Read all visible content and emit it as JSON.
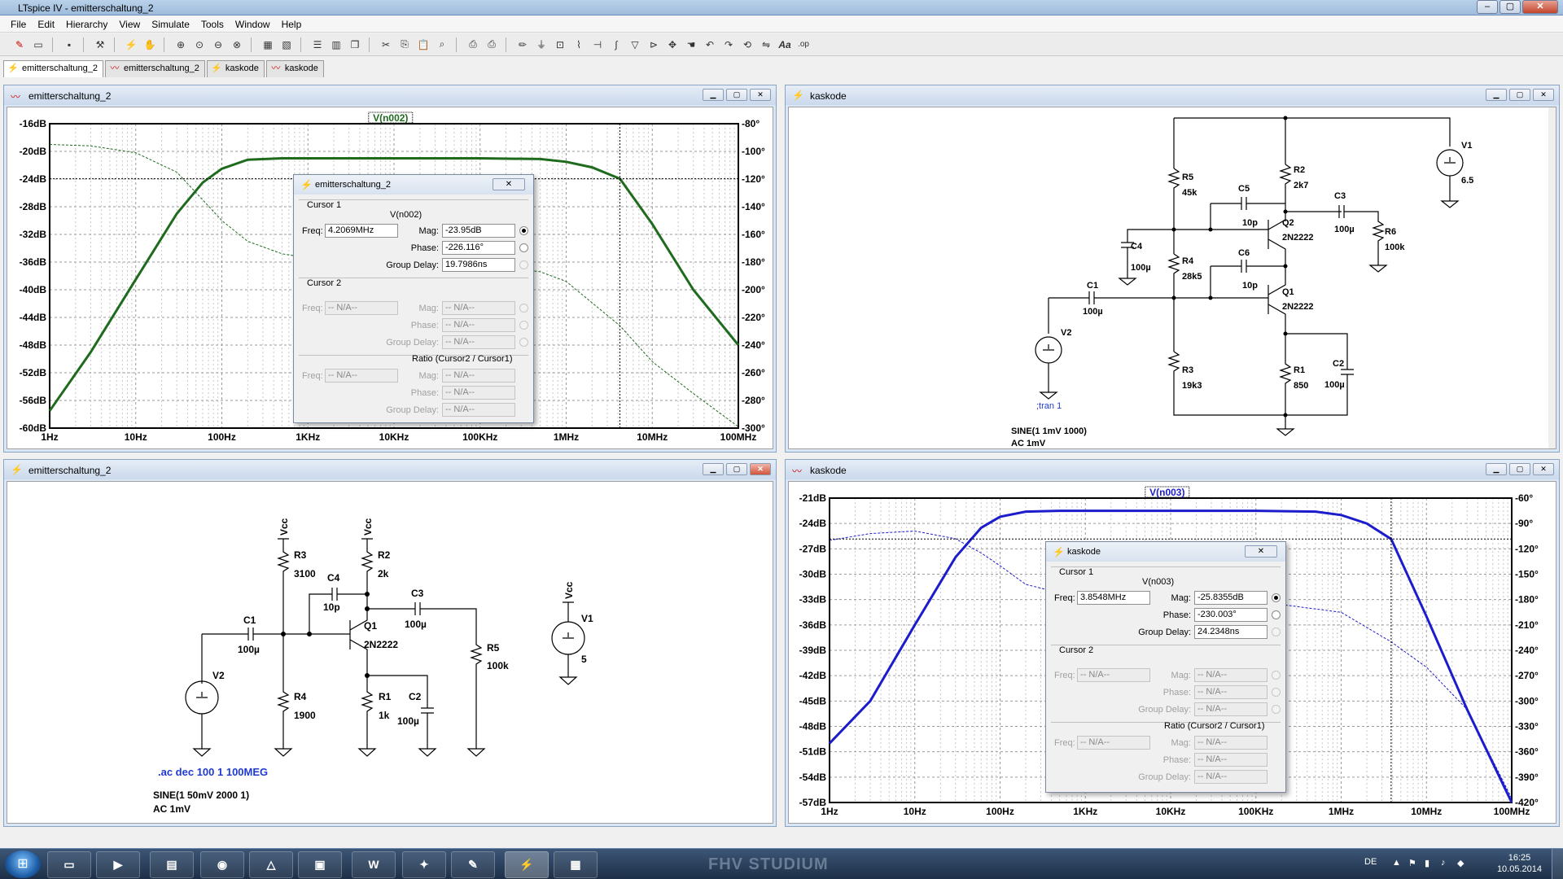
{
  "app": {
    "title": "LTspice IV - emitterschaltung_2",
    "min": "0",
    "max": "1",
    "close": "r"
  },
  "menu": [
    "File",
    "Edit",
    "Hierarchy",
    "View",
    "Simulate",
    "Tools",
    "Window",
    "Help"
  ],
  "tabs": [
    {
      "label": "emitterschaltung_2",
      "kind": "schematic"
    },
    {
      "label": "emitterschaltung_2",
      "kind": "plot"
    },
    {
      "label": "kaskode",
      "kind": "schematic"
    },
    {
      "label": "kaskode",
      "kind": "plot"
    }
  ],
  "windows": {
    "w1": {
      "title": "emitterschaltung_2"
    },
    "w2": {
      "title": "kaskode"
    },
    "w3": {
      "title": "emitterschaltung_2"
    },
    "w4": {
      "title": "kaskode"
    }
  },
  "chart_data": [
    {
      "type": "line",
      "title": "V(n002)",
      "x_scale": "log",
      "xlim": [
        1,
        100000000
      ],
      "x_ticks": [
        "1Hz",
        "10Hz",
        "100Hz",
        "1KHz",
        "10KHz",
        "100KHz",
        "1MHz",
        "10MHz",
        "100MHz"
      ],
      "ylim_left": [
        -60,
        -16
      ],
      "y_ticks_left": [
        "-16dB",
        "-20dB",
        "-24dB",
        "-28dB",
        "-32dB",
        "-36dB",
        "-40dB",
        "-44dB",
        "-48dB",
        "-52dB",
        "-56dB",
        "-60dB"
      ],
      "y_ticks_right": [
        "-80°",
        "-100°",
        "-120°",
        "-140°",
        "-160°",
        "-180°",
        "-200°",
        "-220°",
        "-240°",
        "-260°",
        "-280°",
        "-300°"
      ],
      "ylim_right": [
        -300,
        -80
      ],
      "grid": true,
      "series": [
        {
          "name": "Mag",
          "style": "solid",
          "color": "#1e6b1e",
          "x": [
            1,
            3,
            10,
            30,
            60,
            100,
            200,
            500,
            1000,
            10000,
            100000,
            500000,
            1000000,
            2000000,
            4206900,
            10000000,
            30000000,
            100000000
          ],
          "y": [
            -57.5,
            -49,
            -38.5,
            -29,
            -24.5,
            -22.5,
            -21.2,
            -21,
            -21,
            -21,
            -21,
            -21.1,
            -21.5,
            -22.3,
            -23.95,
            -30.5,
            -40,
            -48
          ]
        },
        {
          "name": "Phase",
          "style": "dashed",
          "color": "#1e6b1e",
          "x": [
            1,
            3,
            10,
            30,
            60,
            100,
            200,
            500,
            1000,
            10000,
            100000,
            500000,
            1000000,
            4206900,
            10000000,
            30000000,
            100000000
          ],
          "y": [
            -95,
            -96,
            -101,
            -115,
            -135,
            -150,
            -165,
            -174,
            -177,
            -180,
            -182,
            -187,
            -194,
            -226,
            -252,
            -275,
            -299
          ]
        }
      ],
      "cursor": {
        "freq": 4206900,
        "mag": -23.95
      }
    },
    {
      "type": "line",
      "title": "V(n003)",
      "x_scale": "log",
      "xlim": [
        1,
        100000000
      ],
      "x_ticks": [
        "1Hz",
        "10Hz",
        "100Hz",
        "1KHz",
        "10KHz",
        "100KHz",
        "1MHz",
        "10MHz",
        "100MHz"
      ],
      "ylim_left": [
        -57,
        -21
      ],
      "y_ticks_left": [
        "-21dB",
        "-24dB",
        "-27dB",
        "-30dB",
        "-33dB",
        "-36dB",
        "-39dB",
        "-42dB",
        "-45dB",
        "-48dB",
        "-51dB",
        "-54dB",
        "-57dB"
      ],
      "y_ticks_right": [
        "-60°",
        "-90°",
        "-120°",
        "-150°",
        "-180°",
        "-210°",
        "-240°",
        "-270°",
        "-300°",
        "-330°",
        "-360°",
        "-390°",
        "-420°"
      ],
      "ylim_right": [
        -420,
        -60
      ],
      "grid": true,
      "series": [
        {
          "name": "Mag",
          "style": "solid",
          "color": "#1c1ccc",
          "x": [
            1,
            3,
            10,
            30,
            60,
            100,
            200,
            500,
            1000,
            10000,
            100000,
            500000,
            1000000,
            2000000,
            3854800,
            10000000,
            30000000,
            100000000
          ],
          "y": [
            -50,
            -45,
            -36,
            -28,
            -24.5,
            -23.2,
            -22.6,
            -22.5,
            -22.5,
            -22.5,
            -22.5,
            -22.6,
            -23,
            -24,
            -25.84,
            -35,
            -46,
            -57
          ]
        },
        {
          "name": "Phase",
          "style": "dashed",
          "color": "#1c1ccc",
          "x": [
            1,
            3,
            10,
            30,
            60,
            100,
            200,
            500,
            1000,
            3000,
            10000,
            100000,
            1000000,
            3854800,
            10000000,
            30000000,
            100000000
          ],
          "y": [
            -110,
            -102,
            -99,
            -108,
            -125,
            -140,
            -162,
            -172,
            -175,
            -178,
            -180,
            -182,
            -195,
            -230,
            -260,
            -310,
            -415
          ]
        }
      ],
      "cursor": {
        "freq": 3854800,
        "mag": -25.8355
      }
    }
  ],
  "dialog1": {
    "title": "emitterschaltung_2",
    "cursor1": "Cursor 1",
    "trace": "V(n002)",
    "freq_label": "Freq:",
    "freq": "4.2069MHz",
    "mag_label": "Mag:",
    "mag": "-23.95dB",
    "phase_label": "Phase:",
    "phase": "-226.116°",
    "gd_label": "Group Delay:",
    "gd": "19.7986ns",
    "cursor2": "Cursor 2",
    "na": "-- N/A--",
    "ratio": "Ratio (Cursor2 / Cursor1)"
  },
  "dialog2": {
    "title": "kaskode",
    "cursor1": "Cursor 1",
    "trace": "V(n003)",
    "freq_label": "Freq:",
    "freq": "3.8548MHz",
    "mag_label": "Mag:",
    "mag": "-25.8355dB",
    "phase_label": "Phase:",
    "phase": "-230.003°",
    "gd_label": "Group Delay:",
    "gd": "24.2348ns",
    "cursor2": "Cursor 2",
    "na": "-- N/A--",
    "ratio": "Ratio (Cursor2 / Cursor1)"
  },
  "kaskode": {
    "R5": "R5",
    "R5v": "45k",
    "R2": "R2",
    "R2v": "2k7",
    "C5": "C5",
    "C5v": "10p",
    "Q2": "Q2",
    "Q2v": "2N2222",
    "C3": "C3",
    "C3v": "100µ",
    "R6": "R6",
    "R6v": "100k",
    "C4": "C4",
    "C4v": "100µ",
    "R4": "R4",
    "R4v": "28k5",
    "C6": "C6",
    "C6v": "10p",
    "Q1": "Q1",
    "Q1v": "2N2222",
    "C1": "C1",
    "C1v": "100µ",
    "V2": "V2",
    "tran": ";tran 1",
    "R3": "R3",
    "R3v": "19k3",
    "R1": "R1",
    "R1v": "850",
    "C2": "C2",
    "C2v": "100µ",
    "V1": "V1",
    "V1v": "6.5",
    "sine": "SINE(1 1mV 1000)",
    "ac": "AC 1mV"
  },
  "emitter": {
    "vcc": "Vcc",
    "R3": "R3",
    "R3v": "3100",
    "R2": "R2",
    "R2v": "2k",
    "C4": "C4",
    "C4v": "10p",
    "C3": "C3",
    "C3v": "100µ",
    "Q1": "Q1",
    "Q1v": "2N2222",
    "C1": "C1",
    "C1v": "100µ",
    "R5": "R5",
    "R5v": "100k",
    "V1": "V1",
    "V1v": "5",
    "V2": "V2",
    "R4": "R4",
    "R4v": "1900",
    "R1": "R1",
    "R1v": "1k",
    "C2": "C2",
    "C2v": "100µ",
    "acdir": ".ac dec 100 1 100MEG",
    "sine": "SINE(1 50mV 2000 1)",
    "ac": "AC 1mV"
  },
  "taskbar": {
    "lang": "DE",
    "time": "16:25",
    "date": "10.05.2014",
    "watermark": "FHV STUDIUM"
  },
  "colors": {
    "plot_green": "#1e6b1e",
    "plot_blue": "#1c1ccc",
    "schematic_text_blue": "#1f3ad0"
  }
}
